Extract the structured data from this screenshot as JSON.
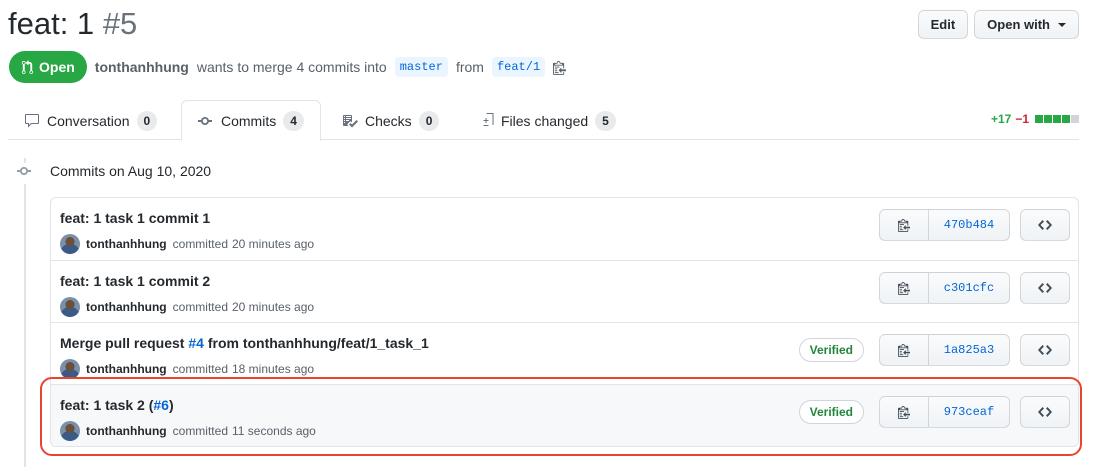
{
  "pr": {
    "title": "feat: 1",
    "number": "#5",
    "actions": {
      "edit": "Edit",
      "open_with": "Open with"
    },
    "state": "Open",
    "author": "tonthanhhung",
    "merge_text": "wants to merge 4 commits into",
    "base_branch": "master",
    "from_text": "from",
    "head_branch": "feat/1"
  },
  "tabs": [
    {
      "label": "Conversation",
      "count": "0",
      "icon": "comment-icon"
    },
    {
      "label": "Commits",
      "count": "4",
      "icon": "commit-icon",
      "selected": true
    },
    {
      "label": "Checks",
      "count": "0",
      "icon": "checklist-icon"
    },
    {
      "label": "Files changed",
      "count": "5",
      "icon": "diff-icon"
    }
  ],
  "diffstat": {
    "additions": "+17",
    "deletions": "−1",
    "blocks": [
      "green",
      "green",
      "green",
      "green",
      "gray"
    ]
  },
  "colors": {
    "green": "#28a745",
    "red": "#cb2431",
    "gray": "#d1d5da",
    "link": "#0366d6",
    "highlight": "#e8452c"
  },
  "timeline": {
    "heading": "Commits on Aug 10, 2020"
  },
  "commits": [
    {
      "message": "feat: 1 task 1 commit 1",
      "author": "tonthanhhung",
      "action": "committed",
      "time": "20 minutes ago",
      "sha": "470b484",
      "verified": ""
    },
    {
      "message": "feat: 1 task 1 commit 2",
      "author": "tonthanhhung",
      "action": "committed",
      "time": "20 minutes ago",
      "sha": "c301cfc",
      "verified": ""
    },
    {
      "message_prefix": "Merge pull request ",
      "message_link": "#4",
      "message_suffix": " from tonthanhhung/feat/1_task_1",
      "author": "tonthanhhung",
      "action": "committed",
      "time": "18 minutes ago",
      "sha": "1a825a3",
      "verified": "Verified"
    },
    {
      "message_prefix": "feat: 1 task 2 (",
      "message_link": "#6",
      "message_suffix": ")",
      "author": "tonthanhhung",
      "action": "committed",
      "time": "11 seconds ago",
      "sha": "973ceaf",
      "verified": "Verified"
    }
  ]
}
